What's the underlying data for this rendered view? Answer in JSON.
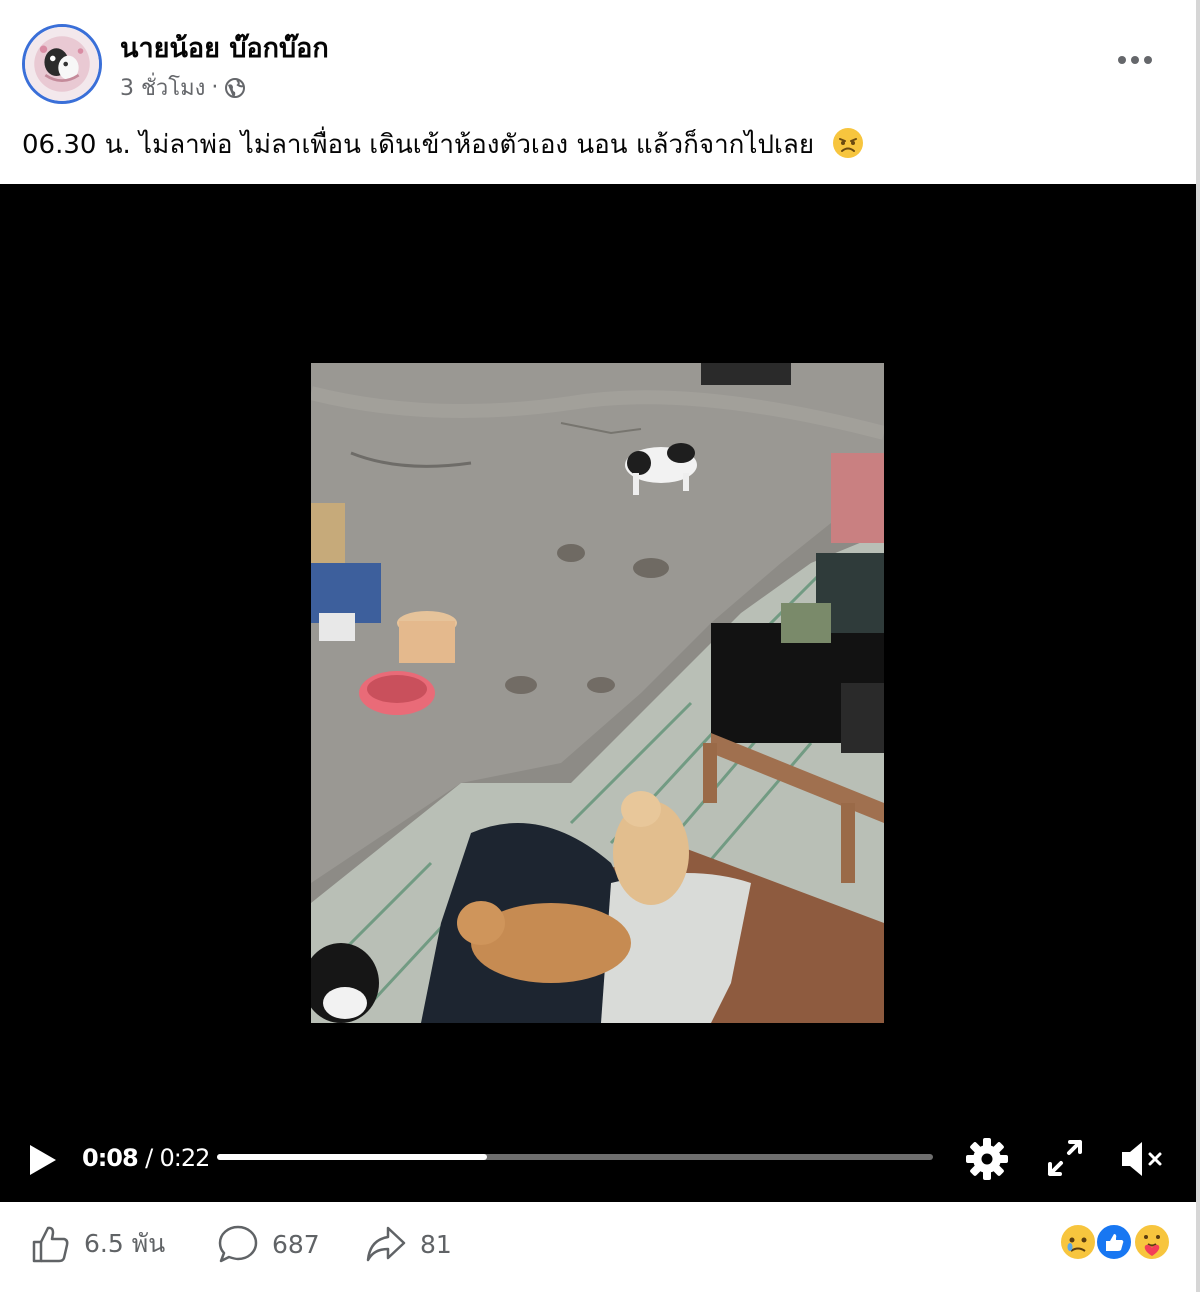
{
  "post": {
    "author": "นายน้อย บ๊อกบ๊อก",
    "time": "3 ชั่วโมง",
    "separator": "·",
    "privacy_icon": "globe-icon",
    "caption": "06.30 น. ไม่ลาพ่อ ไม่ลาเพื่อน เดินเข้าห้องตัวเอง นอน แล้วก็จากไปเลย",
    "caption_emoji": "sad-face-emoji"
  },
  "video": {
    "current_time": "0:08",
    "time_separator": "/",
    "duration": "0:22",
    "progress_fraction": 0.377,
    "controls": [
      "play-icon",
      "gear-icon",
      "expand-icon",
      "muted-speaker-icon"
    ]
  },
  "stats": {
    "likes": "6.5 พัน",
    "comments": "687",
    "shares": "81",
    "reactions": [
      "sad-reaction",
      "like-reaction",
      "care-reaction"
    ]
  },
  "colors": {
    "text_primary": "#050505",
    "text_secondary": "#65676b",
    "video_bg": "#000000",
    "like_blue": "#1877f2"
  }
}
